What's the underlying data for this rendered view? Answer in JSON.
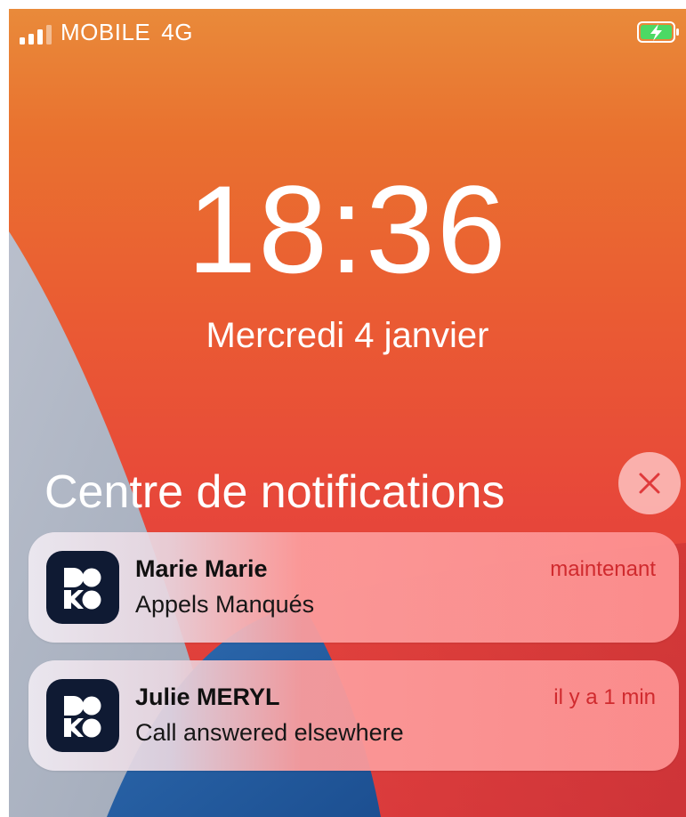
{
  "status_bar": {
    "carrier": "MOBILE",
    "network": "4G",
    "signal_icon": "cellular-signal-icon",
    "battery_icon": "battery-charging-icon",
    "battery_color": "#4cd964"
  },
  "lock_screen": {
    "time": "18:36",
    "date": "Mercredi 4 janvier"
  },
  "notification_center": {
    "title": "Centre de notifications",
    "close_icon": "close-icon",
    "accent_color": "#e0393b"
  },
  "notifications": [
    {
      "app_icon": "doko-app-icon",
      "sender": "Marie Marie",
      "message": "Appels Manqués",
      "time": "maintenant"
    },
    {
      "app_icon": "doko-app-icon",
      "sender": "Julie MERYL",
      "message": "Call answered elsewhere",
      "time": "il y a 1 min"
    }
  ]
}
